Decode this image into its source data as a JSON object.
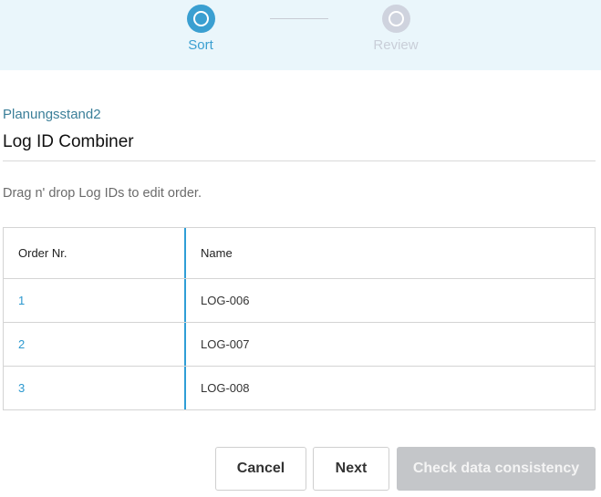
{
  "stepper": {
    "steps": [
      {
        "label": "Sort",
        "state": "active",
        "color": "#3a9fd1"
      },
      {
        "label": "Review",
        "state": "inactive",
        "color": "#cfd3de"
      }
    ]
  },
  "header": {
    "subtitle": "Planungsstand2",
    "title": "Log ID Combiner"
  },
  "hint": "Drag n' drop Log IDs to edit order.",
  "table": {
    "columns": [
      "Order Nr.",
      "Name"
    ],
    "rows": [
      {
        "order": "1",
        "name": "LOG-006"
      },
      {
        "order": "2",
        "name": "LOG-007"
      },
      {
        "order": "3",
        "name": "LOG-008"
      }
    ]
  },
  "actions": {
    "cancel_label": "Cancel",
    "next_label": "Next",
    "check_label": "Check data consistency",
    "check_disabled": true
  }
}
